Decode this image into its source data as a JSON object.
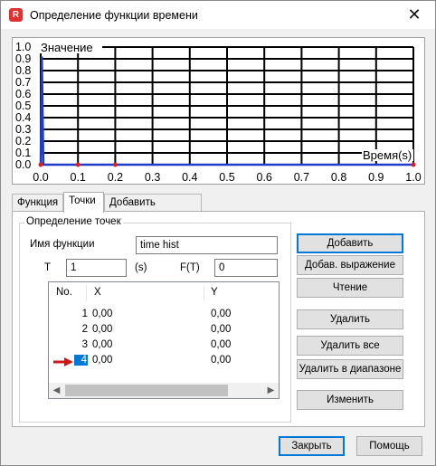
{
  "window": {
    "title": "Определение функции времени",
    "app_icon_letter": "R",
    "close_glyph": "✕"
  },
  "chart_data": {
    "type": "line",
    "ylabel": "Значение",
    "xlabel": "Время(s)",
    "xlim": [
      0,
      1
    ],
    "ylim": [
      0,
      1
    ],
    "x_ticks": [
      "0.0",
      "0.1",
      "0.2",
      "0.3",
      "0.4",
      "0.5",
      "0.6",
      "0.7",
      "0.8",
      "0.9",
      "1.0"
    ],
    "y_ticks": [
      "0.0",
      "0.1",
      "0.2",
      "0.3",
      "0.4",
      "0.5",
      "0.6",
      "0.7",
      "0.8",
      "0.9",
      "1.0"
    ],
    "grid": true,
    "series": [
      {
        "x": [
          0,
          0.003,
          0.007,
          1
        ],
        "y": [
          0,
          0.92,
          0,
          0
        ]
      }
    ],
    "points": [
      {
        "x": 0,
        "y": 0
      },
      {
        "x": 0.1,
        "y": 0
      },
      {
        "x": 0.2,
        "y": 0
      },
      {
        "x": 1,
        "y": 0
      }
    ],
    "line_color": "#1f3cc8",
    "point_color": "#e02020"
  },
  "tabs": [
    {
      "label": "Функция",
      "active": false
    },
    {
      "label": "Точки",
      "active": true
    },
    {
      "label": "Добавить функции",
      "active": false
    }
  ],
  "points_group": {
    "title": "Определение точек",
    "func_name_label": "Имя функции",
    "func_name_value": "time hist",
    "t_label": "T",
    "t_value": "1",
    "t_unit": "(s)",
    "ft_label": "F(T)",
    "ft_value": "0"
  },
  "table": {
    "columns": [
      "No.",
      "X",
      "Y"
    ],
    "rows": [
      {
        "no": "1",
        "x": "0,00",
        "y": "0,00",
        "selected": false
      },
      {
        "no": "2",
        "x": "0,00",
        "y": "0,00",
        "selected": false
      },
      {
        "no": "3",
        "x": "0,00",
        "y": "0,00",
        "selected": false
      },
      {
        "no": "4",
        "x": "0,00",
        "y": "0,00",
        "selected": true
      }
    ]
  },
  "buttons": {
    "add": "Добавить",
    "add_expr": "Добав. выражение",
    "read": "Чтение",
    "delete": "Удалить",
    "delete_all": "Удалить все",
    "delete_range": "Удалить в диапазоне",
    "modify": "Изменить",
    "close": "Закрыть",
    "help": "Помощь"
  },
  "scroll": {
    "left_glyph": "◀",
    "right_glyph": "▶"
  }
}
